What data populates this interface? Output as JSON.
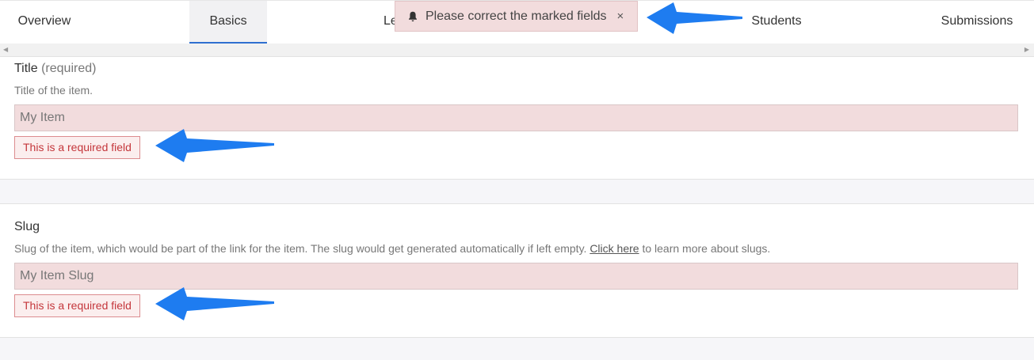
{
  "tabs": [
    {
      "label": "Overview"
    },
    {
      "label": "Basics"
    },
    {
      "label": "Le"
    },
    {
      "label": "Students"
    },
    {
      "label": "Submissions"
    }
  ],
  "toast": {
    "icon": "bell-icon",
    "message": "Please correct the marked fields",
    "close": "×"
  },
  "title_field": {
    "label": "Title",
    "required": "(required)",
    "description": "Title of the item.",
    "placeholder": "My Item",
    "error": "This is a required field"
  },
  "slug_field": {
    "label": "Slug",
    "description_before": "Slug of the item, which would be part of the link for the item. The slug would get generated automatically if left empty.",
    "link_text": "Click here",
    "description_after": "to learn more about slugs.",
    "placeholder": "My Item Slug",
    "error": "This is a required field"
  },
  "colors": {
    "accent": "#2f6fd0",
    "error_bg": "#f2dcdd",
    "error_text": "#c4363b",
    "annotation_arrow": "#1e7cf0"
  }
}
